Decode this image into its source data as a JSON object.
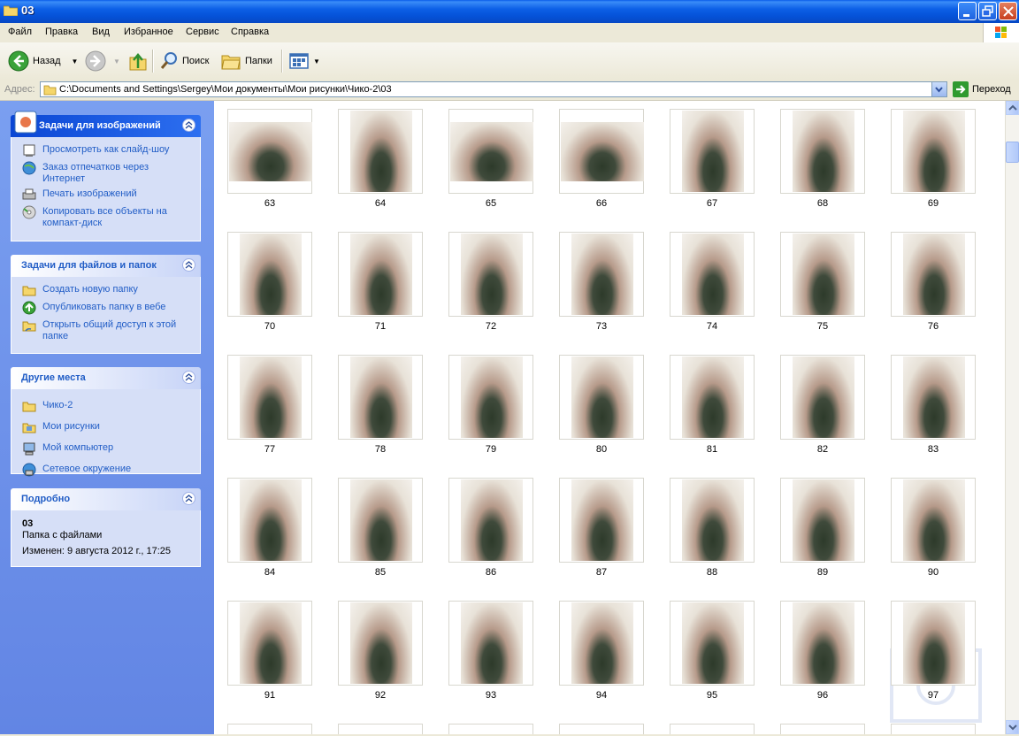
{
  "window": {
    "title": "03"
  },
  "menu": [
    "Файл",
    "Правка",
    "Вид",
    "Избранное",
    "Сервис",
    "Справка"
  ],
  "toolbar": {
    "back": "Назад",
    "search": "Поиск",
    "folders": "Папки"
  },
  "address": {
    "label": "Адрес:",
    "path": "C:\\Documents and Settings\\Sergey\\Мои документы\\Мои рисунки\\Чико-2\\03",
    "go": "Переход"
  },
  "image_tasks": {
    "title": "Задачи для изображений",
    "items": [
      "Просмотреть как слайд-шоу",
      "Заказ отпечатков через Интернет",
      "Печать изображений",
      "Копировать все объекты на компакт-диск"
    ]
  },
  "file_tasks": {
    "title": "Задачи для файлов и папок",
    "items": [
      "Создать новую папку",
      "Опубликовать папку в вебе",
      "Открыть общий доступ к этой папке"
    ]
  },
  "other_places": {
    "title": "Другие места",
    "items": [
      "Чико-2",
      "Мои рисунки",
      "Мой компьютер",
      "Сетевое окружение"
    ]
  },
  "details": {
    "title": "Подробно",
    "name": "03",
    "type": "Папка с файлами",
    "modified": "Изменен: 9 августа 2012 г., 17:25"
  },
  "thumbnails": [
    "63",
    "64",
    "65",
    "66",
    "67",
    "68",
    "69",
    "70",
    "71",
    "72",
    "73",
    "74",
    "75",
    "76",
    "77",
    "78",
    "79",
    "80",
    "81",
    "82",
    "83",
    "84",
    "85",
    "86",
    "87",
    "88",
    "89",
    "90",
    "91",
    "92",
    "93",
    "94",
    "95",
    "96",
    "97"
  ]
}
